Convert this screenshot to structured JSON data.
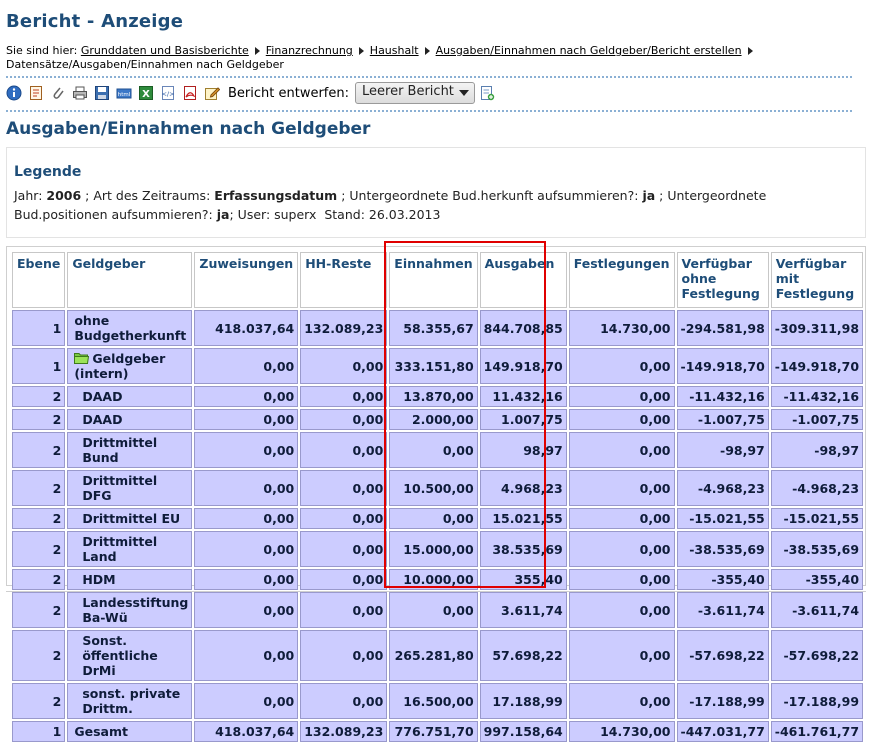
{
  "page": {
    "title": "Bericht - Anzeige",
    "breadcrumb": {
      "prefix": "Sie sind hier:",
      "links": [
        "Grunddaten und Basisberichte",
        "Finanzrechnung",
        "Haushalt",
        "Ausgaben/Einnahmen nach Geldgeber/Bericht erstellen"
      ],
      "current": "Datensätze/Ausgaben/Einnahmen nach Geldgeber"
    }
  },
  "toolbar": {
    "icons": [
      "info-icon",
      "report-icon",
      "attachment-icon",
      "print-icon",
      "save-icon",
      "html-export-icon",
      "excel-export-icon",
      "xml-export-icon",
      "pdf-export-icon",
      "edit-icon"
    ],
    "design_label": "Bericht entwerfen:",
    "design_select_value": "Leerer Bericht",
    "new_report_icon": "new-report-icon"
  },
  "report": {
    "title": "Ausgaben/Einnahmen nach Geldgeber",
    "legend": {
      "title": "Legende",
      "jahr_label": "Jahr:",
      "jahr_value": "2006",
      "zeitraum_label": "; Art des Zeitraums:",
      "zeitraum_value": "Erfassungsdatum",
      "herkunft_label": "; Untergeordnete Bud.herkunft aufsummieren?:",
      "herkunft_value": "ja",
      "positionen_label": "; Untergeordnete Bud.positionen aufsummieren?:",
      "positionen_value": "ja",
      "user_text": "; User: superx",
      "stand_text": "Stand: 26.03.2013"
    }
  },
  "table": {
    "headers": [
      "Ebene",
      "Geldgeber",
      "Zuweisungen",
      "HH-Reste",
      "Einnahmen",
      "Ausgaben",
      "Festlegungen",
      "Verfügbar ohne Festlegung",
      "Verfügbar mit Festlegung"
    ],
    "rows": [
      {
        "ebene": "1",
        "name": "ohne Budgetherkunft",
        "icon": "",
        "zuweisungen": "418.037,64",
        "hh_reste": "132.089,23",
        "einnahmen": "58.355,67",
        "ausgaben": "844.708,85",
        "festlegungen": "14.730,00",
        "verf_ohne": "-294.581,98",
        "verf_mit": "-309.311,98"
      },
      {
        "ebene": "1",
        "name": "Geldgeber (intern)",
        "icon": "folder-icon",
        "zuweisungen": "0,00",
        "hh_reste": "0,00",
        "einnahmen": "333.151,80",
        "ausgaben": "149.918,70",
        "festlegungen": "0,00",
        "verf_ohne": "-149.918,70",
        "verf_mit": "-149.918,70"
      },
      {
        "ebene": "2",
        "name": "DAAD",
        "icon": "",
        "zuweisungen": "0,00",
        "hh_reste": "0,00",
        "einnahmen": "13.870,00",
        "ausgaben": "11.432,16",
        "festlegungen": "0,00",
        "verf_ohne": "-11.432,16",
        "verf_mit": "-11.432,16"
      },
      {
        "ebene": "2",
        "name": "DAAD",
        "icon": "",
        "zuweisungen": "0,00",
        "hh_reste": "0,00",
        "einnahmen": "2.000,00",
        "ausgaben": "1.007,75",
        "festlegungen": "0,00",
        "verf_ohne": "-1.007,75",
        "verf_mit": "-1.007,75"
      },
      {
        "ebene": "2",
        "name": "Drittmittel Bund",
        "icon": "",
        "zuweisungen": "0,00",
        "hh_reste": "0,00",
        "einnahmen": "0,00",
        "ausgaben": "98,97",
        "festlegungen": "0,00",
        "verf_ohne": "-98,97",
        "verf_mit": "-98,97"
      },
      {
        "ebene": "2",
        "name": "Drittmittel DFG",
        "icon": "",
        "zuweisungen": "0,00",
        "hh_reste": "0,00",
        "einnahmen": "10.500,00",
        "ausgaben": "4.968,23",
        "festlegungen": "0,00",
        "verf_ohne": "-4.968,23",
        "verf_mit": "-4.968,23"
      },
      {
        "ebene": "2",
        "name": "Drittmittel EU",
        "icon": "",
        "zuweisungen": "0,00",
        "hh_reste": "0,00",
        "einnahmen": "0,00",
        "ausgaben": "15.021,55",
        "festlegungen": "0,00",
        "verf_ohne": "-15.021,55",
        "verf_mit": "-15.021,55"
      },
      {
        "ebene": "2",
        "name": "Drittmittel Land",
        "icon": "",
        "zuweisungen": "0,00",
        "hh_reste": "0,00",
        "einnahmen": "15.000,00",
        "ausgaben": "38.535,69",
        "festlegungen": "0,00",
        "verf_ohne": "-38.535,69",
        "verf_mit": "-38.535,69"
      },
      {
        "ebene": "2",
        "name": "HDM",
        "icon": "",
        "zuweisungen": "0,00",
        "hh_reste": "0,00",
        "einnahmen": "10.000,00",
        "ausgaben": "355,40",
        "festlegungen": "0,00",
        "verf_ohne": "-355,40",
        "verf_mit": "-355,40"
      },
      {
        "ebene": "2",
        "name": "Landesstiftung Ba-Wü",
        "icon": "",
        "zuweisungen": "0,00",
        "hh_reste": "0,00",
        "einnahmen": "0,00",
        "ausgaben": "3.611,74",
        "festlegungen": "0,00",
        "verf_ohne": "-3.611,74",
        "verf_mit": "-3.611,74"
      },
      {
        "ebene": "2",
        "name": "Sonst. öffentliche DrMi",
        "icon": "",
        "zuweisungen": "0,00",
        "hh_reste": "0,00",
        "einnahmen": "265.281,80",
        "ausgaben": "57.698,22",
        "festlegungen": "0,00",
        "verf_ohne": "-57.698,22",
        "verf_mit": "-57.698,22"
      },
      {
        "ebene": "2",
        "name": "sonst. private Drittm.",
        "icon": "",
        "zuweisungen": "0,00",
        "hh_reste": "0,00",
        "einnahmen": "16.500,00",
        "ausgaben": "17.188,99",
        "festlegungen": "0,00",
        "verf_ohne": "-17.188,99",
        "verf_mit": "-17.188,99"
      },
      {
        "ebene": "1",
        "name": "Gesamt",
        "icon": "",
        "zuweisungen": "418.037,64",
        "hh_reste": "132.089,23",
        "einnahmen": "776.751,70",
        "ausgaben": "997.158,64",
        "festlegungen": "14.730,00",
        "verf_ohne": "-447.031,77",
        "verf_mit": "-461.761,77"
      }
    ]
  },
  "colors": {
    "title": "#1e4d78",
    "row_background": "#ccccff",
    "highlight": "#e00000"
  }
}
